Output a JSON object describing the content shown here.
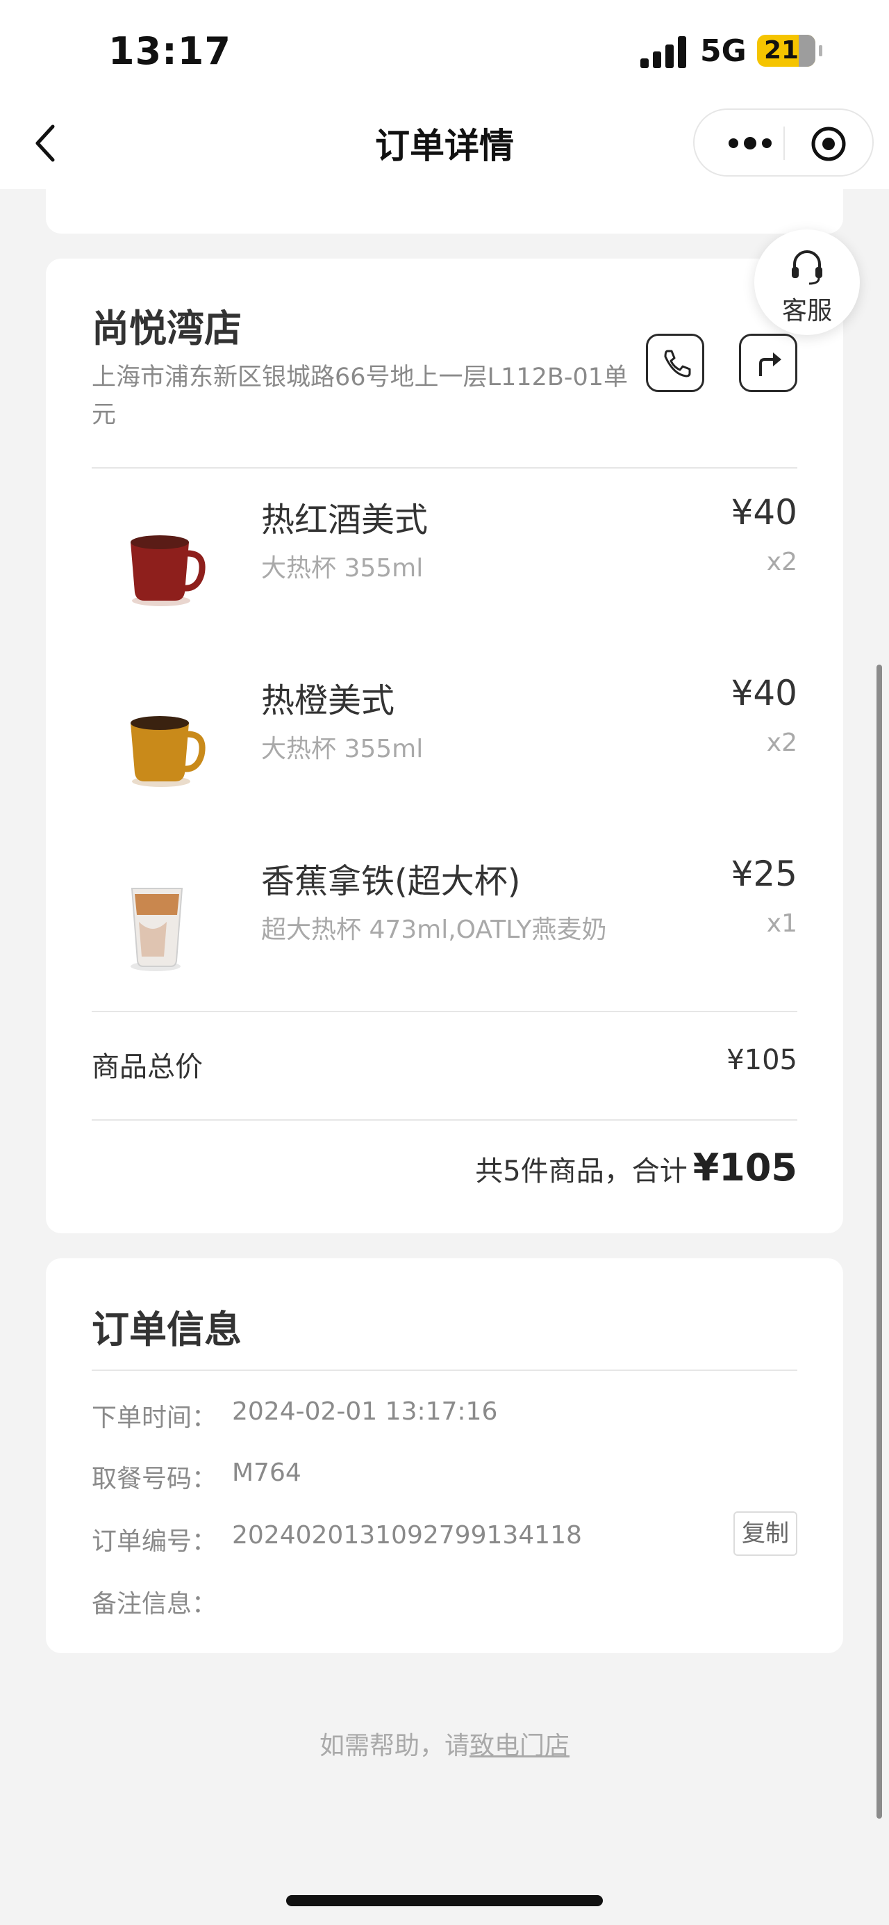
{
  "status_bar": {
    "time": "13:17",
    "network": "5G",
    "battery": "21"
  },
  "nav": {
    "title": "订单详情"
  },
  "service_button": {
    "label": "客服"
  },
  "store": {
    "name": "尚悦湾店",
    "address": "上海市浦东新区银城路66号地上一层L112B-01单元"
  },
  "items": [
    {
      "name": "热红酒美式",
      "spec": "大热杯 355ml",
      "price": "¥40",
      "qty": "x2"
    },
    {
      "name": "热橙美式",
      "spec": "大热杯 355ml",
      "price": "¥40",
      "qty": "x2"
    },
    {
      "name": "香蕉拿铁(超大杯)",
      "spec": "超大热杯 473ml,OATLY燕麦奶",
      "price": "¥25",
      "qty": "x1"
    }
  ],
  "subtotal": {
    "label": "商品总价",
    "value": "¥105"
  },
  "summary": {
    "text": "共5件商品，合计",
    "value": "¥105"
  },
  "order_info": {
    "title": "订单信息",
    "rows": [
      {
        "label": "下单时间：",
        "value": "2024-02-01 13:17:16"
      },
      {
        "label": "取餐号码：",
        "value": "M764"
      },
      {
        "label": "订单编号：",
        "value": "20240201310927991341​18"
      },
      {
        "label": "备注信息：",
        "value": ""
      }
    ],
    "copy_label": "复制"
  },
  "help": {
    "prefix": "如需帮助，请",
    "link": "致电门店"
  },
  "colors": {
    "background": "#f3f3f3",
    "card": "#ffffff",
    "battery": "#f5c400"
  }
}
